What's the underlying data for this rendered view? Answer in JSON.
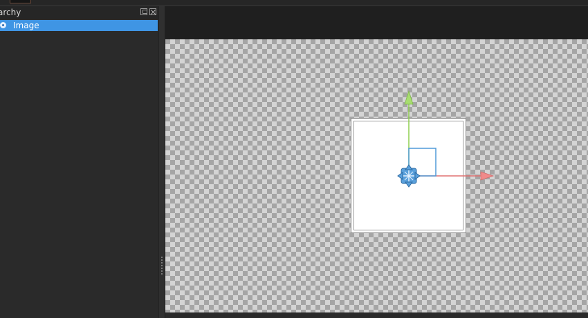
{
  "hierarchy": {
    "title": "archy",
    "items": [
      {
        "label": "Image",
        "selected": true
      }
    ]
  },
  "gizmo": {
    "x_axis_color": "#e07070",
    "y_axis_color": "#8fcf4f",
    "plane_handle_color": "#4f9ad8",
    "center_icon": "move-arrows-icon"
  },
  "colors": {
    "selection": "#3f95e4",
    "panel_bg": "#2a2a2a",
    "toolbar_bg": "#1f1f1f"
  }
}
